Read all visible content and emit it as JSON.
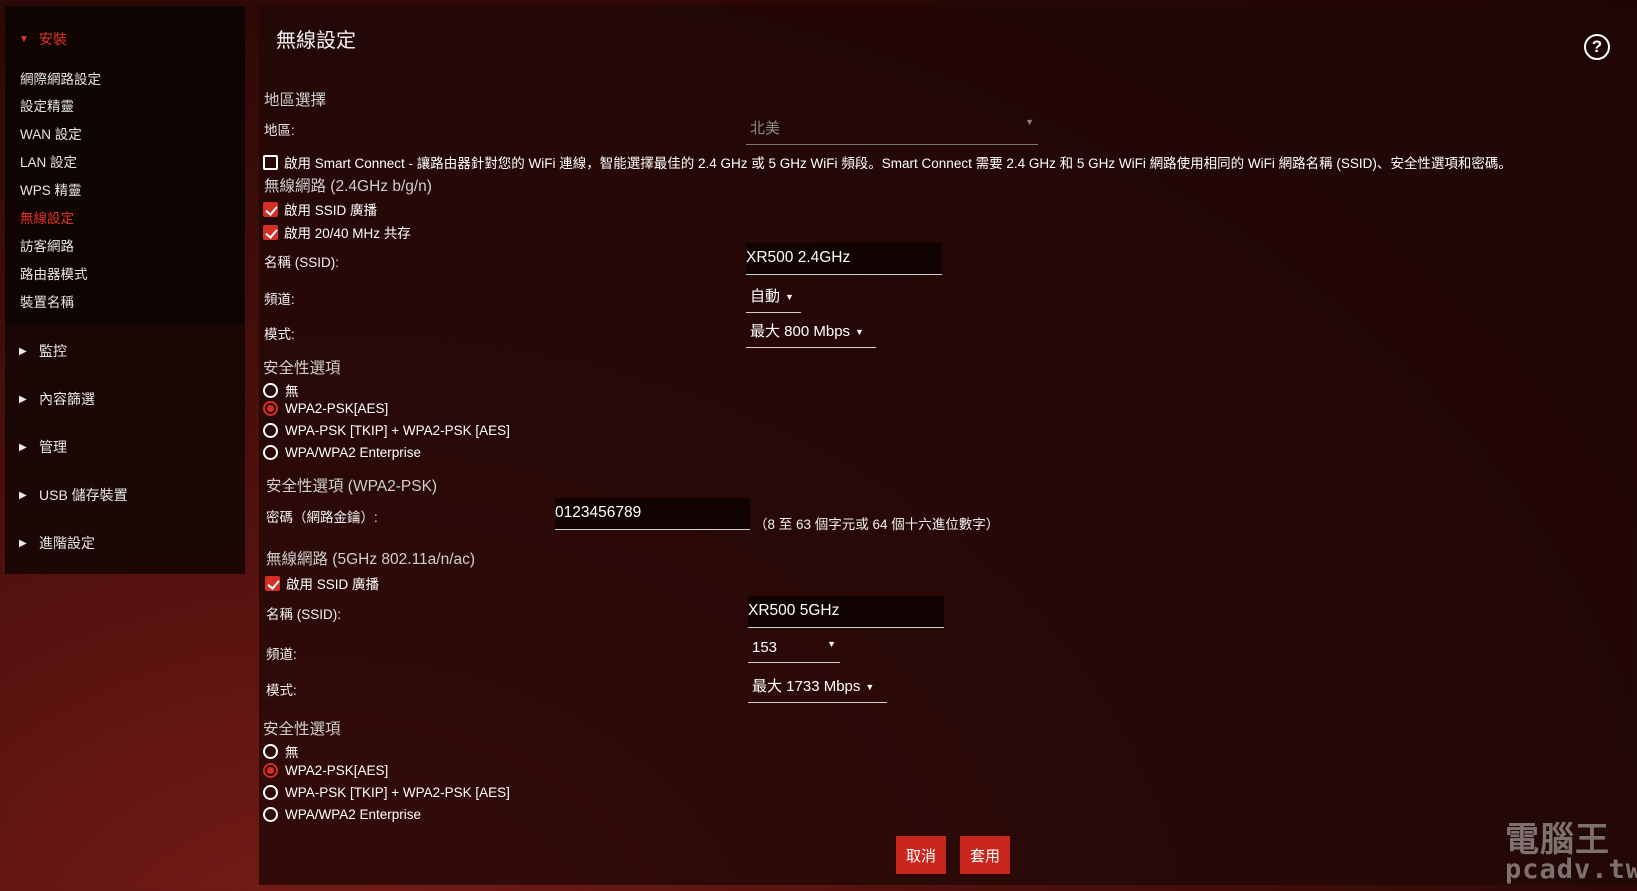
{
  "sidebar": {
    "install": {
      "label": "安裝",
      "items": [
        "網際網路設定",
        "設定精靈",
        "WAN 設定",
        "LAN 設定",
        "WPS 精靈",
        "無線設定",
        "訪客網路",
        "路由器模式",
        "裝置名稱"
      ]
    },
    "sections": [
      "監控",
      "內容篩選",
      "管理",
      "USB 儲存裝置",
      "進階設定"
    ]
  },
  "page": {
    "title": "無線設定",
    "help_icon": "help-circle-icon"
  },
  "region": {
    "title": "地區選擇",
    "label": "地區:",
    "value": "北美"
  },
  "smart_connect": {
    "checked": false,
    "text": "啟用 Smart Connect - 讓路由器針對您的 WiFi 連線，智能選擇最佳的 2.4 GHz 或 5 GHz WiFi 頻段。Smart Connect 需要 2.4 GHz 和 5 GHz WiFi 網路使用相同的 WiFi 網路名稱 (SSID)、安全性選項和密碼。"
  },
  "band24": {
    "title": "無線網路 (2.4GHz b/g/n)",
    "ssid_broadcast": "啟用 SSID 廣播",
    "coexist": "啟用 20/40 MHz 共存",
    "ssid_label": "名稱 (SSID):",
    "ssid_value": "XR500 2.4GHz",
    "channel_label": "頻道:",
    "channel_value": "自動",
    "mode_label": "模式:",
    "mode_value": "最大 800 Mbps",
    "security_title": "安全性選項",
    "security_options": [
      "無",
      "WPA2-PSK[AES]",
      "WPA-PSK [TKIP] + WPA2-PSK [AES]",
      "WPA/WPA2 Enterprise"
    ],
    "security_selected": 1,
    "psk_title": "安全性選項 (WPA2-PSK)",
    "password_label": "密碼（網路金鑰）:",
    "password_value": "0123456789",
    "password_hint": "（8 至 63 個字元或 64 個十六進位數字）"
  },
  "band5": {
    "title": "無線網路 (5GHz 802.11a/n/ac)",
    "ssid_broadcast": "啟用 SSID 廣播",
    "ssid_label": "名稱 (SSID):",
    "ssid_value": "XR500 5GHz",
    "channel_label": "頻道:",
    "channel_value": "153",
    "mode_label": "模式:",
    "mode_value": "最大 1733 Mbps",
    "security_title": "安全性選項",
    "security_options": [
      "無",
      "WPA2-PSK[AES]",
      "WPA-PSK [TKIP] + WPA2-PSK [AES]",
      "WPA/WPA2 Enterprise"
    ],
    "security_selected": 1
  },
  "buttons": {
    "cancel": "取消",
    "apply": "套用"
  },
  "watermark": {
    "line1": "電腦王",
    "line2": "pcadv.tw"
  },
  "colors": {
    "accent": "#d32f25",
    "background": "#2a0806"
  }
}
